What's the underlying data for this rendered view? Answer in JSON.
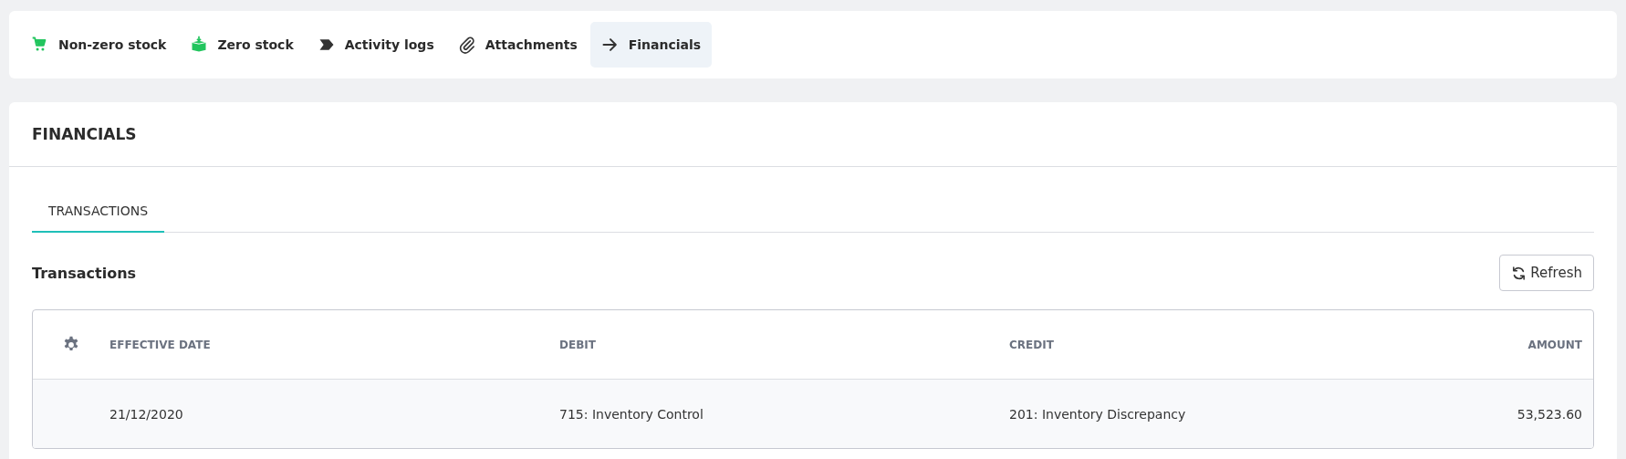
{
  "nav_tabs": [
    {
      "label": "Non-zero stock",
      "selected": false
    },
    {
      "label": "Zero stock",
      "selected": false
    },
    {
      "label": "Activity logs",
      "selected": false
    },
    {
      "label": "Attachments",
      "selected": false
    },
    {
      "label": "Financials",
      "selected": true
    }
  ],
  "panel": {
    "title": "FINANCIALS",
    "tabs": [
      {
        "label": "TRANSACTIONS",
        "selected": true
      }
    ],
    "section_title": "Transactions",
    "refresh_button": "Refresh",
    "table": {
      "columns": [
        "EFFECTIVE DATE",
        "DEBIT",
        "CREDIT",
        "AMOUNT"
      ],
      "rows": [
        {
          "cells": [
            "21/12/2020",
            "715: Inventory Control",
            "201: Inventory Discrepancy",
            "53,523.60"
          ]
        }
      ]
    }
  }
}
